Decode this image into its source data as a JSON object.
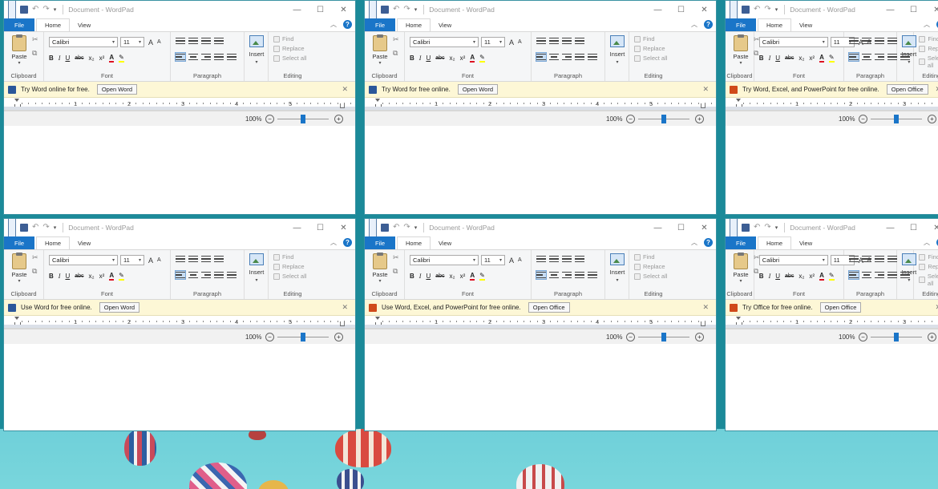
{
  "app": {
    "title": "Document - WordPad"
  },
  "window_controls": {
    "minimize": "—",
    "maximize": "☐",
    "close": "✕"
  },
  "quick_access": {
    "undo": "↶",
    "redo": "↷",
    "caret": "▾"
  },
  "tabs": {
    "file": "File",
    "home": "Home",
    "view": "View"
  },
  "ribbon": {
    "groups": {
      "clipboard": "Clipboard",
      "font": "Font",
      "paragraph": "Paragraph",
      "editing": "Editing"
    },
    "paste": "Paste",
    "insert": "Insert",
    "font_name": "Calibri",
    "font_size": "11",
    "grow": "A",
    "shrink": "A",
    "bold": "B",
    "italic": "I",
    "underline": "U",
    "strike": "abc",
    "subscript": "x₂",
    "superscript": "x²",
    "font_color": "A",
    "highlight": "✎",
    "find": "Find",
    "replace": "Replace",
    "select_all": "Select all",
    "dropdown": "▾"
  },
  "ruler": {
    "numbers": [
      "1",
      "2",
      "3",
      "4",
      "5"
    ]
  },
  "zoom": {
    "level": "100%",
    "minus": "−",
    "plus": "+",
    "value": 0.5
  },
  "windows": [
    {
      "notif_text": "Try Word online for free.",
      "notif_button": "Open Word",
      "notif_icon": "word-icon"
    },
    {
      "notif_text": "Try Word for free online.",
      "notif_button": "Open Word",
      "notif_icon": "word-icon"
    },
    {
      "notif_text": "Try Word, Excel, and PowerPoint for free online.",
      "notif_button": "Open Office",
      "notif_icon": "office-icon"
    },
    {
      "notif_text": "Use Word for free online.",
      "notif_button": "Open Word",
      "notif_icon": "word-icon"
    },
    {
      "notif_text": "Use Word, Excel, and PowerPoint for free online.",
      "notif_button": "Open Office",
      "notif_icon": "office-icon"
    },
    {
      "notif_text": "Try Office for free online.",
      "notif_button": "Open Office",
      "notif_icon": "office-icon"
    }
  ],
  "colors": {
    "desktop": "#1b8a99",
    "file_tab": "#1a75c8",
    "notif_bg": "#fdf7d6"
  }
}
